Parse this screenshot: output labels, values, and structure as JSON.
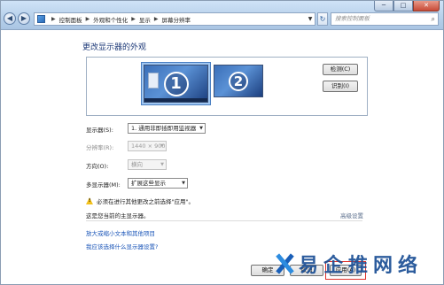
{
  "window": {
    "caption": {
      "minimize": "─",
      "maximize": "□",
      "close": "✕"
    }
  },
  "nav": {
    "back": "◀",
    "forward": "▶"
  },
  "breadcrumb": [
    "控制面板",
    "外观和个性化",
    "显示",
    "屏幕分辨率"
  ],
  "search": {
    "placeholder": "搜索控制面板"
  },
  "page": {
    "heading": "更改显示器的外观",
    "monitors": [
      {
        "number": "1",
        "selected": true
      },
      {
        "number": "2",
        "selected": false
      }
    ],
    "detect_button": "检测(C)",
    "identify_button": "识别(I)"
  },
  "settings": {
    "display": {
      "label": "显示器(S):",
      "value": "1. 通用非即插即用监视器"
    },
    "resolution": {
      "label": "分辨率(R):",
      "value": "1440 × 900"
    },
    "orientation": {
      "label": "方向(O):",
      "value": "横向"
    },
    "multi_display": {
      "label": "多显示器(M):",
      "value": "扩展这些显示"
    }
  },
  "warning": "必须在进行其他更改之前选择\"应用\"。",
  "primary_text": "这是您当前的主显示器。",
  "advanced_link": "高级设置",
  "links": [
    "放大或缩小文本和其他项目",
    "我应该选择什么显示器设置?"
  ],
  "footer": {
    "ok": "确定",
    "cancel": "取消",
    "apply": "应用(A)"
  },
  "watermark": {
    "text": "易企推网络"
  },
  "colors": {
    "accent_red": "#e0332b",
    "link_blue": "#1a55b8",
    "heading_blue": "#1e3a78"
  }
}
